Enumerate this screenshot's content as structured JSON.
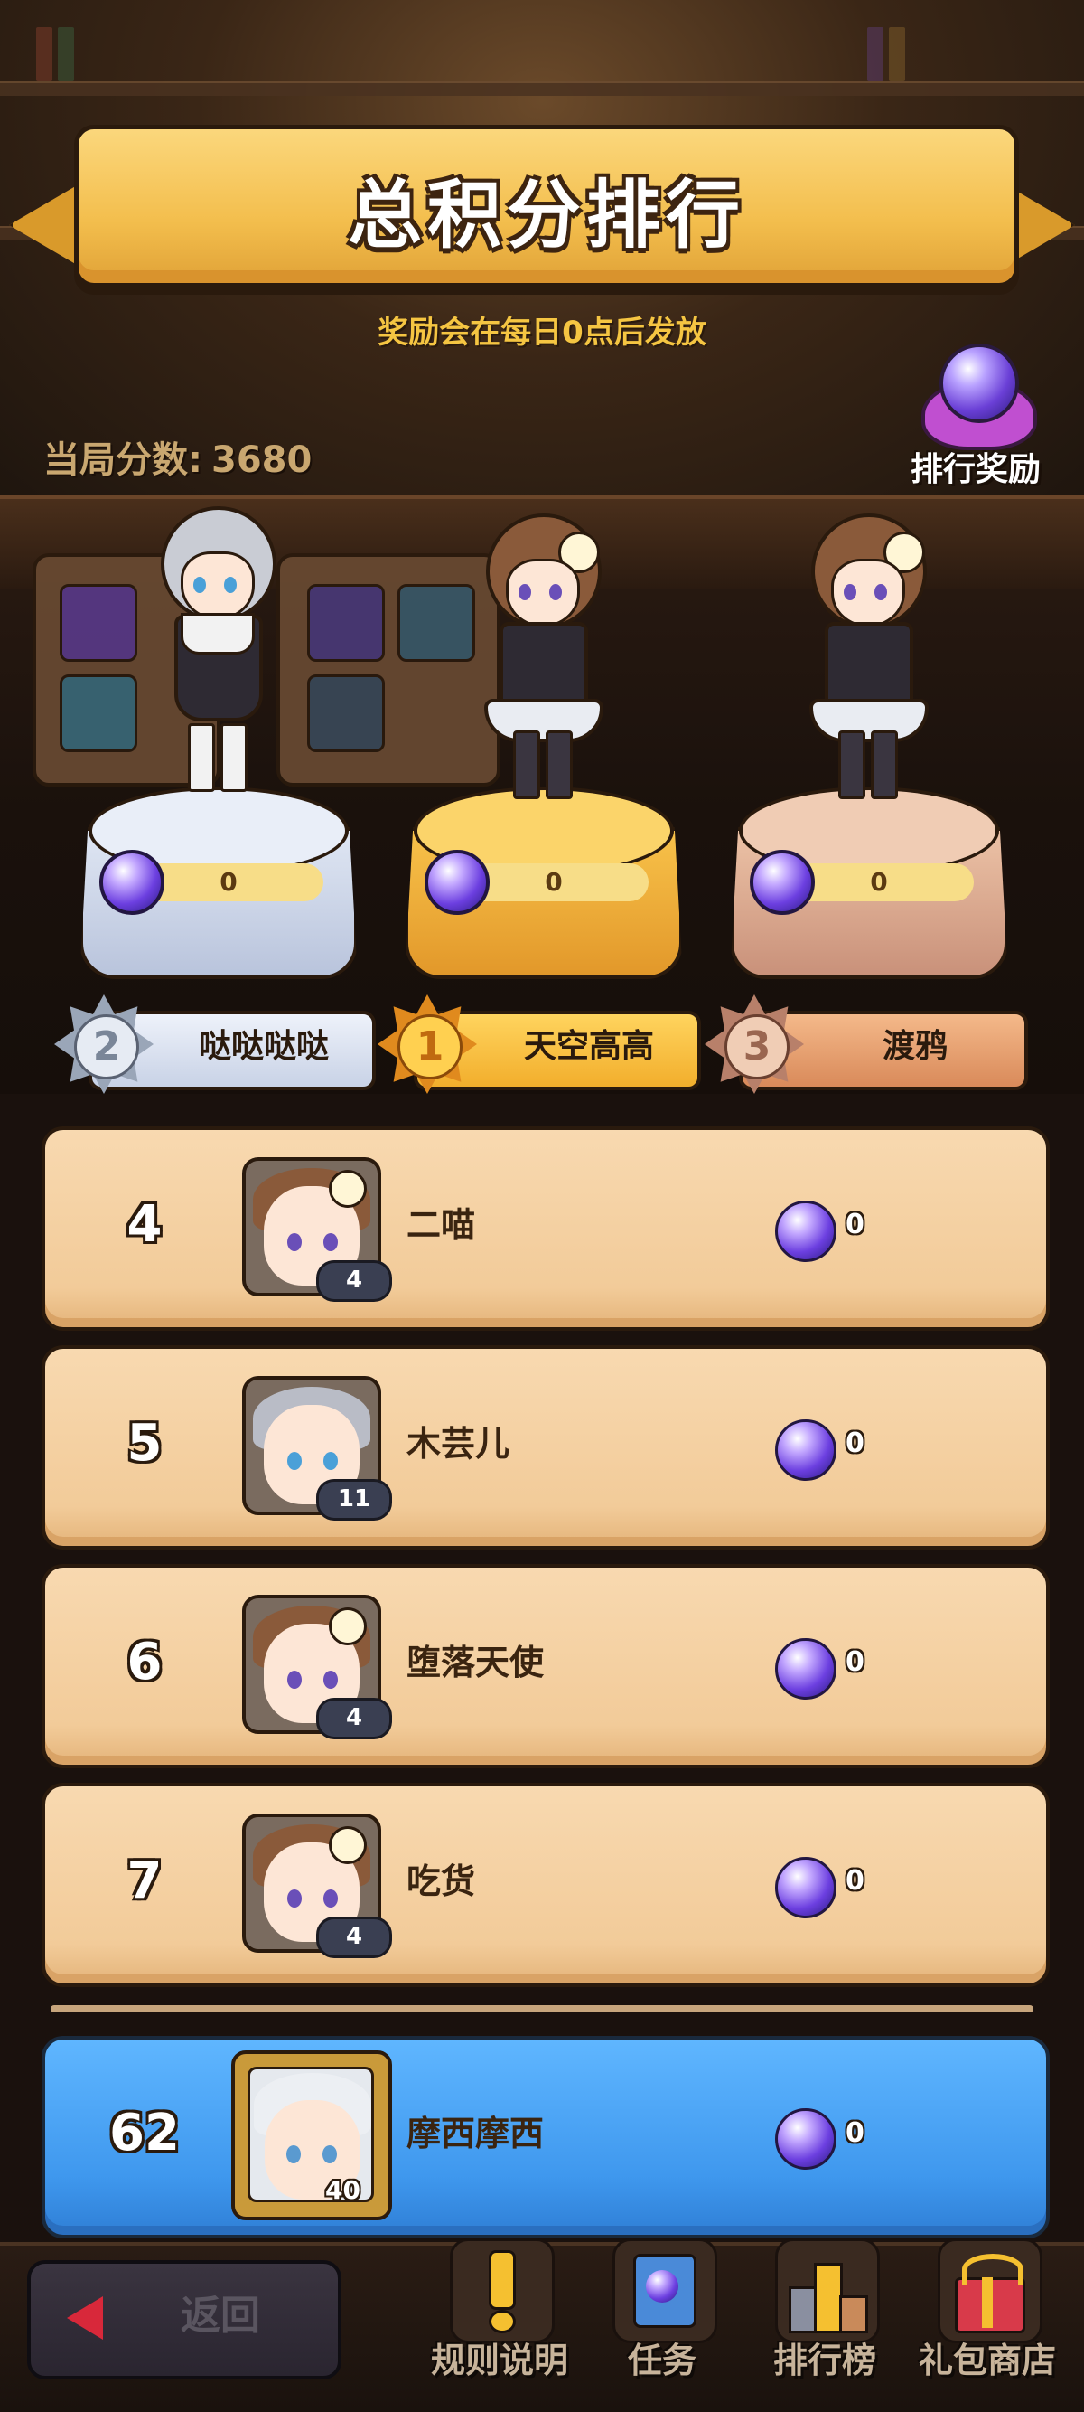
{
  "header": {
    "title": "总积分排行",
    "subtitle": "奖励会在每日0点后发放"
  },
  "score": {
    "label": "当局分数:",
    "value": "3680"
  },
  "reward_button": {
    "label": "排行奖励",
    "icon": "crystal-orb-icon"
  },
  "podium": [
    {
      "rank": "2",
      "name": "哒哒哒哒",
      "value": "0",
      "color": "#cfd7e8"
    },
    {
      "rank": "1",
      "name": "天空高高",
      "value": "0",
      "color": "#f3b23a"
    },
    {
      "rank": "3",
      "name": "渡鸦",
      "value": "0",
      "color": "#e8b79a"
    }
  ],
  "ranking": [
    {
      "rank": "4",
      "name": "二喵",
      "level": "4",
      "value": "0"
    },
    {
      "rank": "5",
      "name": "木芸儿",
      "level": "11",
      "value": "0"
    },
    {
      "rank": "6",
      "name": "堕落天使",
      "level": "4",
      "value": "0"
    },
    {
      "rank": "7",
      "name": "吃货",
      "level": "4",
      "value": "0"
    }
  ],
  "self": {
    "rank": "62",
    "name": "摩西摩西",
    "level": "40",
    "value": "0"
  },
  "bottom_nav": {
    "back_label": "返回",
    "items": [
      {
        "label": "规则说明",
        "icon": "exclamation-icon"
      },
      {
        "label": "任务",
        "icon": "task-card-icon"
      },
      {
        "label": "排行榜",
        "icon": "leaderboard-icon"
      },
      {
        "label": "礼包商店",
        "icon": "gift-shop-icon"
      }
    ]
  },
  "colors": {
    "banner": "#f3be4d",
    "row": "#f2cb99",
    "self_row": "#3f98ee",
    "orb": "#6c3fe0"
  }
}
